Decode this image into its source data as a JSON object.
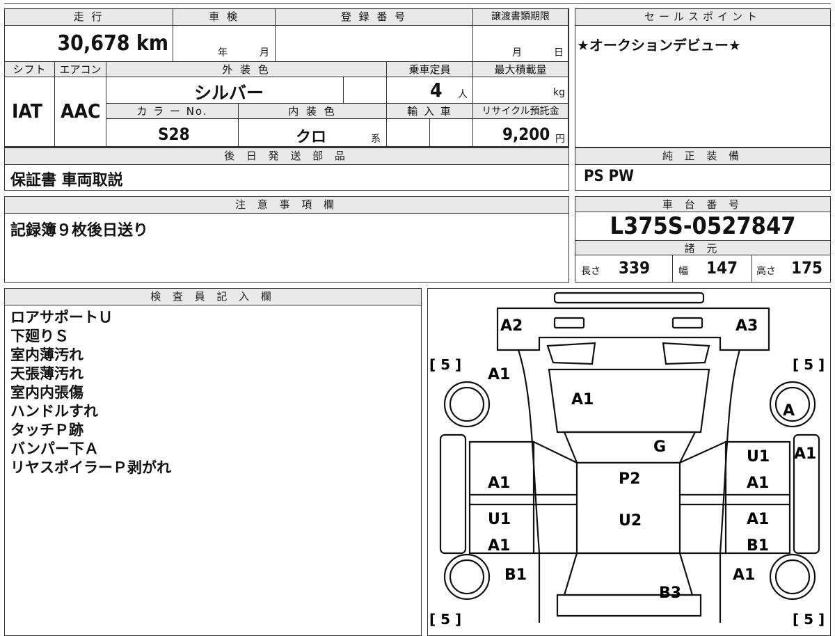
{
  "top_row": {
    "labels": [
      "走 行",
      "車 検",
      "登 録 番 号",
      "譲渡書類期限",
      "セールスポイント"
    ]
  },
  "mileage": "30,678 km",
  "shaken_year_unit": "年",
  "shaken_month_unit": "月",
  "deadline_month_unit": "月",
  "deadline_day_unit": "日",
  "sales_point": "★オークションデビュー★",
  "row2_labels": {
    "shift": "シフト",
    "aircon": "エアコン",
    "exterior_color": "外 装 色",
    "capacity": "乗車定員",
    "max_load": "最大積載量"
  },
  "shift": "IAT",
  "aircon": "AAC",
  "exterior_color": "シルバー",
  "capacity": "4",
  "capacity_unit": "人",
  "load_unit": "kg",
  "row3_labels": {
    "color_no": "カ ラ ー No.",
    "interior_color": "内 装 色",
    "import": "輸 入 車",
    "recycle": "リサイクル預託金"
  },
  "color_no": "S28",
  "interior_color": "クロ",
  "interior_suffix": "系",
  "recycle_fee": "9,200",
  "recycle_unit": "円",
  "later_parts_label": "後 日 発 送 部 品",
  "later_parts": "保証書 車両取説",
  "genuine_label": "純 正 装 備",
  "genuine_equipment": "PS PW",
  "notes_label": "注 意 事 項 欄",
  "notes": "記録簿９枚後日送り",
  "chassis_label": "車 台 番 号",
  "chassis_no": "L375S-0527847",
  "specs_label": "諸 元",
  "specs": {
    "length_label": "長さ",
    "length": "339",
    "width_label": "幅",
    "width": "147",
    "height_label": "高さ",
    "height": "175"
  },
  "inspector_label": "検 査 員 記 入 欄",
  "inspector_notes": [
    "ロアサポートＵ",
    "下廻りＳ",
    "室内薄汚れ",
    "天張薄汚れ",
    "室内内張傷",
    "ハンドルすれ",
    "タッチＰ跡",
    "バンパー下Ａ",
    "リヤスポイラーＰ剥がれ"
  ],
  "diagram": {
    "tire_marks": [
      "[ 5 ]",
      "[ 5 ]",
      "[ 5 ]",
      "[ 5 ]"
    ],
    "codes": [
      "A2",
      "A3",
      "A1",
      "A1",
      "A",
      "G",
      "U1",
      "A1",
      "P2",
      "A1",
      "A1",
      "U1",
      "U2",
      "A1",
      "A1",
      "B1",
      "B1",
      "A1",
      "B3"
    ]
  }
}
